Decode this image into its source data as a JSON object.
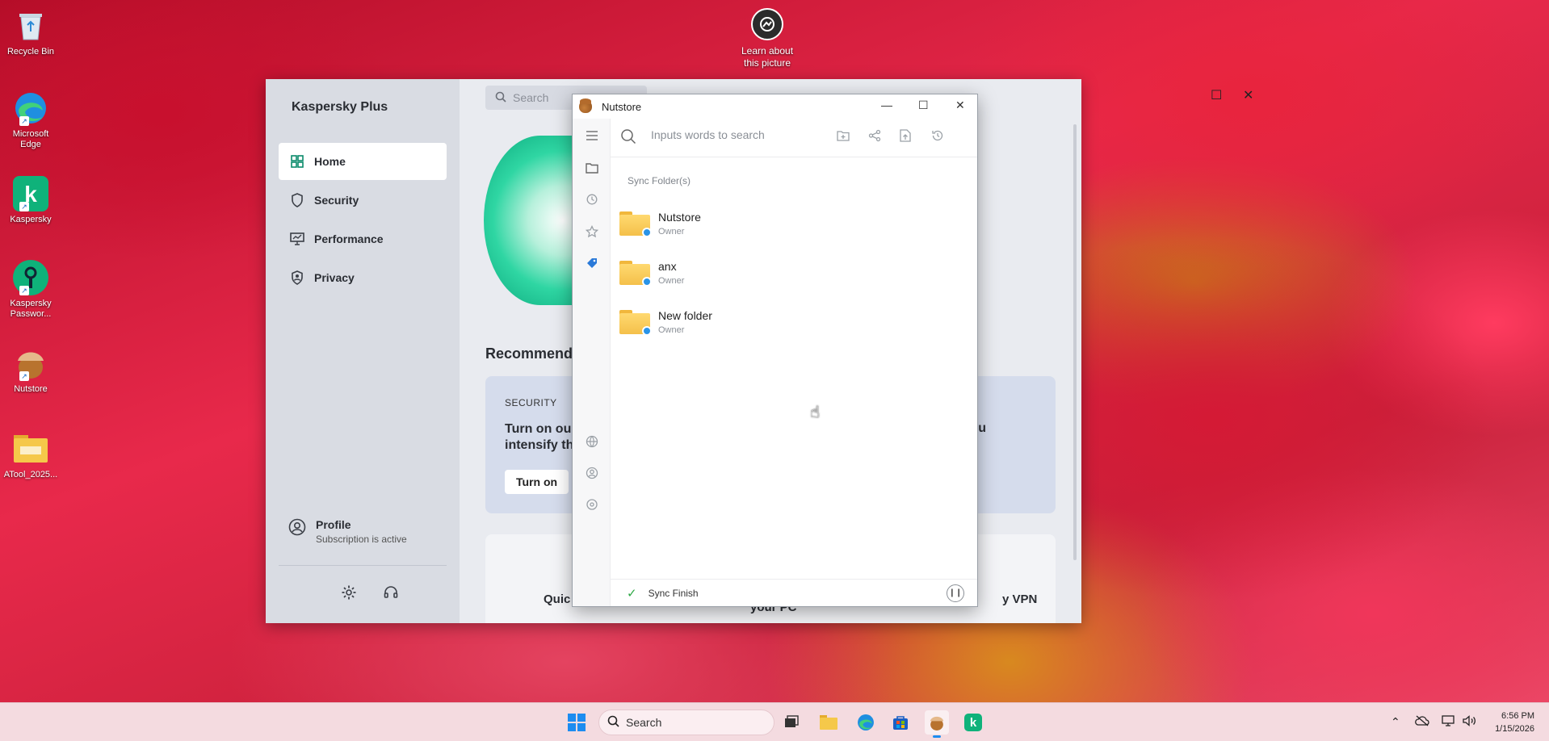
{
  "desktop": {
    "icons": [
      {
        "label": "Recycle Bin",
        "icon": "recycle-bin-icon"
      },
      {
        "label": "Microsoft Edge",
        "icon": "edge-icon"
      },
      {
        "label": "Kaspersky",
        "icon": "kaspersky-icon"
      },
      {
        "label": "Kaspersky Passwor...",
        "icon": "kaspersky-password-icon"
      },
      {
        "label": "Nutstore",
        "icon": "nutstore-icon"
      },
      {
        "label": "ATool_2025...",
        "icon": "folder-icon"
      }
    ],
    "learn_label": "Learn about this picture"
  },
  "kaspersky": {
    "title": "Kaspersky Plus",
    "search_placeholder": "Search",
    "nav": [
      {
        "label": "Home",
        "icon": "home-grid-icon",
        "active": true
      },
      {
        "label": "Security",
        "icon": "shield-icon",
        "active": false
      },
      {
        "label": "Performance",
        "icon": "monitor-icon",
        "active": false
      },
      {
        "label": "Privacy",
        "icon": "privacy-icon",
        "active": false
      }
    ],
    "profile": {
      "name": "Profile",
      "status": "Subscription is active"
    },
    "recommended": "Recommended",
    "card": {
      "label": "SECURITY",
      "text": "Turn on our intensify th",
      "text_right": "u",
      "button": "Turn on"
    },
    "tiles": {
      "t1": "Quic",
      "t2": "your PC",
      "t3": "y VPN"
    }
  },
  "nutstore": {
    "title": "Nutstore",
    "search_placeholder": "Inputs words to search",
    "section": "Sync Folder(s)",
    "folders": [
      {
        "name": "Nutstore",
        "role": "Owner"
      },
      {
        "name": "anx",
        "role": "Owner"
      },
      {
        "name": "New folder",
        "role": "Owner"
      }
    ],
    "status": "Sync Finish"
  },
  "taskbar": {
    "search_label": "Search",
    "time": "6:56 PM",
    "date": "1/15/2026"
  },
  "colors": {
    "kaspersky_accent": "#0a8a6a",
    "nutstore_accent": "#2a79d8",
    "sync_ok": "#2ea845"
  }
}
